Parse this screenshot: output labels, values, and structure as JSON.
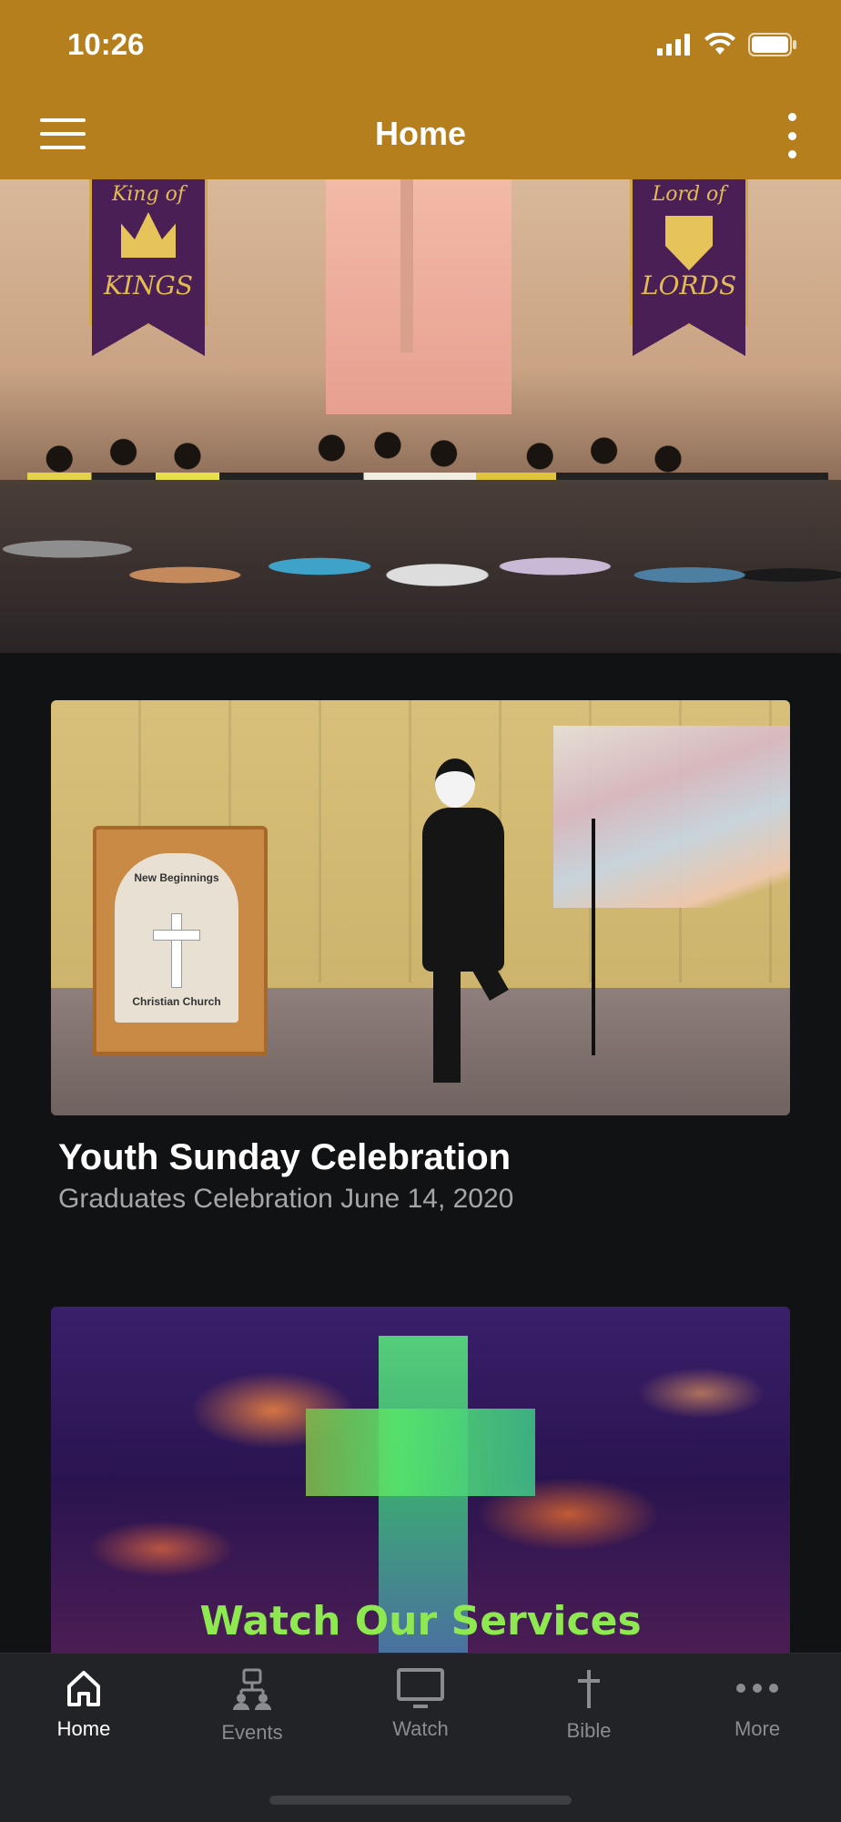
{
  "status_bar": {
    "time": "10:26"
  },
  "header": {
    "title": "Home",
    "background": "#b57f1e"
  },
  "hero": {
    "banner_left": {
      "line1": "King of",
      "line2": "KINGS"
    },
    "banner_right": {
      "line1": "Lord of",
      "line2": "LORDS"
    }
  },
  "cards": [
    {
      "title": "Youth Sunday Celebration",
      "subtitle": "Graduates Celebration June 14, 2020",
      "image_text": {
        "podium_line1": "New Beginnings",
        "podium_line2": "Christian Church"
      }
    },
    {
      "image_text": {
        "overlay": "Watch Our Services"
      }
    }
  ],
  "tabbar": {
    "active": "Home",
    "items": [
      {
        "label": "Home",
        "icon": "home-icon"
      },
      {
        "label": "Events",
        "icon": "events-icon"
      },
      {
        "label": "Watch",
        "icon": "tv-icon"
      },
      {
        "label": "Bible",
        "icon": "cross-icon"
      },
      {
        "label": "More",
        "icon": "more-dots-icon"
      }
    ]
  },
  "colors": {
    "accent": "#b57f1e",
    "background": "#111214",
    "tabbar": "#222326",
    "inactive": "#8b8c90"
  }
}
